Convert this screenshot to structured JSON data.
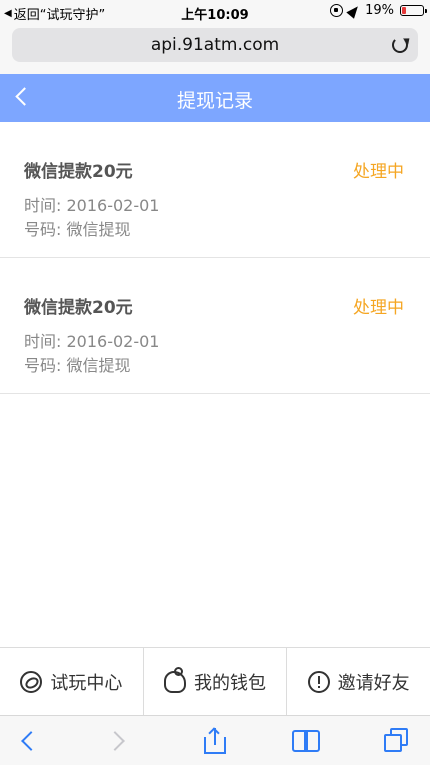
{
  "status_bar": {
    "back_label": "返回“试玩守护”",
    "time": "上午10:09",
    "battery_text": "19%",
    "battery_level": 0.19,
    "battery_color": "#e63a3a"
  },
  "browser": {
    "url": "api.91atm.com"
  },
  "header": {
    "title": "提现记录",
    "background": "#7da6ff"
  },
  "records": [
    {
      "title": "微信提款20元",
      "status": "处理中",
      "time": "时间: 2016-02-01",
      "code": "号码: 微信提现"
    },
    {
      "title": "微信提款20元",
      "status": "处理中",
      "time": "时间: 2016-02-01",
      "code": "号码: 微信提现"
    }
  ],
  "status_color": "#f5a623",
  "tabbar": {
    "tabs": [
      {
        "label": "试玩中心",
        "icon": "play-circle-icon"
      },
      {
        "label": "我的钱包",
        "icon": "piggy-bank-icon"
      },
      {
        "label": "邀请好友",
        "icon": "alert-circle-icon"
      }
    ]
  },
  "toolbar": {
    "icons": [
      "back-icon",
      "forward-icon",
      "share-icon",
      "bookmarks-icon",
      "tabs-icon"
    ],
    "accent": "#2f7cf6"
  }
}
